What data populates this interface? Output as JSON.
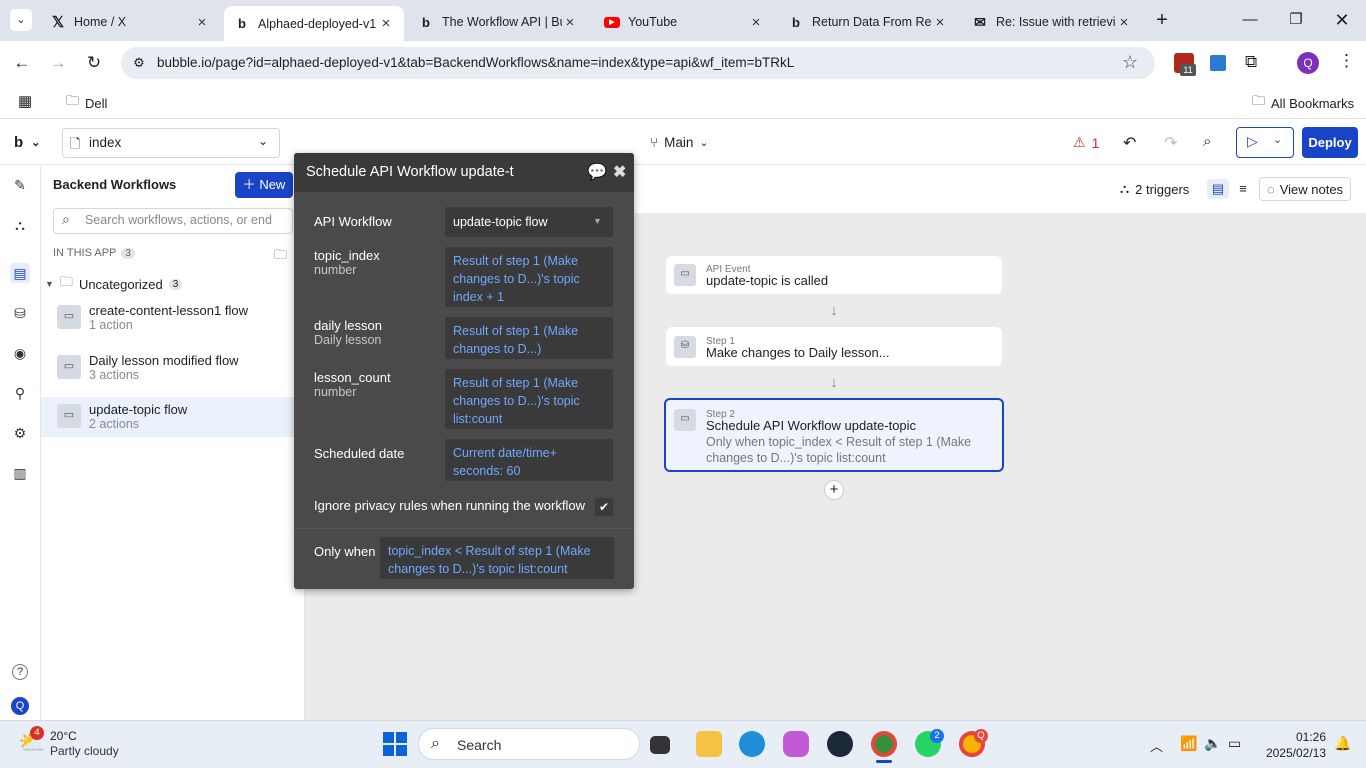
{
  "browser": {
    "tabs": [
      {
        "title": "Home / X",
        "icon": "x-logo-icon"
      },
      {
        "title": "Alphaed-deployed-v1",
        "icon": "bubble-logo-icon",
        "active": true
      },
      {
        "title": "The Workflow API | Bu",
        "icon": "bubble-logo-icon"
      },
      {
        "title": "YouTube",
        "icon": "youtube-icon"
      },
      {
        "title": "Return Data From Re",
        "icon": "bubble-logo-icon"
      },
      {
        "title": "Re: Issue with retrievi",
        "icon": "gmail-icon"
      }
    ],
    "url": "bubble.io/page?id=alphaed-deployed-v1&tab=BackendWorkflows&name=index&type=api&wf_item=bTRkL",
    "bookmarks": {
      "folder": "Dell",
      "all": "All Bookmarks"
    },
    "extension_badge": "11",
    "profile_initial": "Q"
  },
  "editor": {
    "logo": "b",
    "page_name": "index",
    "branch": "Main",
    "issues_count": "1",
    "deploy_label": "Deploy"
  },
  "sidebar": {
    "title": "Backend Workflows",
    "new_label": "New",
    "search_placeholder": "Search workflows, actions, or end",
    "section_label": "IN THIS APP",
    "section_count": "3",
    "folder_label": "Uncategorized",
    "folder_count": "3",
    "items": [
      {
        "name": "create-content-lesson1 flow",
        "count": "1 action"
      },
      {
        "name": "Daily lesson modified flow",
        "count": "3 actions"
      },
      {
        "name": "update-topic flow",
        "count": "2 actions",
        "selected": true
      }
    ],
    "help": "?",
    "user_initial": "Q"
  },
  "canvas_toolbar": {
    "triggers": "2 triggers",
    "view_notes": "View notes"
  },
  "flow": {
    "event": {
      "kind": "API Event",
      "title": "update-topic is called"
    },
    "step1": {
      "kind": "Step 1",
      "title": "Make changes to Daily lesson..."
    },
    "step2": {
      "kind": "Step 2",
      "title": "Schedule API Workflow update-topic",
      "condition_line1": "Only when topic_index < Result of step 1 (Make",
      "condition_line2": "changes to D...)'s topic list:count"
    },
    "add": "+"
  },
  "modal": {
    "title": "Schedule API Workflow update-t",
    "api_workflow_label": "API Workflow",
    "api_workflow_value": "update-topic flow",
    "params": [
      {
        "label": "topic_index",
        "type": "number",
        "lines": [
          "Result of step 1 (Make",
          "changes to D...)'s topic",
          "index + 1"
        ]
      },
      {
        "label": "daily lesson",
        "type": "Daily lesson",
        "lines": [
          "Result of step 1 (Make",
          "changes to D...)"
        ]
      },
      {
        "label": "lesson_count",
        "type": "number",
        "lines": [
          "Result of step 1 (Make",
          "changes to D...)'s topic",
          "list:count"
        ]
      }
    ],
    "scheduled_label": "Scheduled date",
    "scheduled_lines": [
      "Current date/time+",
      "seconds: 60"
    ],
    "privacy_label": "Ignore privacy rules when running the workflow",
    "privacy_checked": true,
    "only_when_label": "Only when",
    "only_when_lines": [
      "topic_index < Result of step 1 (Make",
      "changes to D...)'s topic list:count"
    ]
  },
  "taskbar": {
    "weather_temp": "20°C",
    "weather_desc": "Partly cloudy",
    "weather_badge": "4",
    "search_label": "Search",
    "time": "01:26",
    "date": "2025/02/13",
    "whatsapp_badge": "2",
    "chrome_badge": "Q"
  },
  "colors": {
    "accent": "#1a44c8",
    "link_blue": "#6ea8ff",
    "modal_bg": "#4a4a4a",
    "warning": "#d93025"
  }
}
